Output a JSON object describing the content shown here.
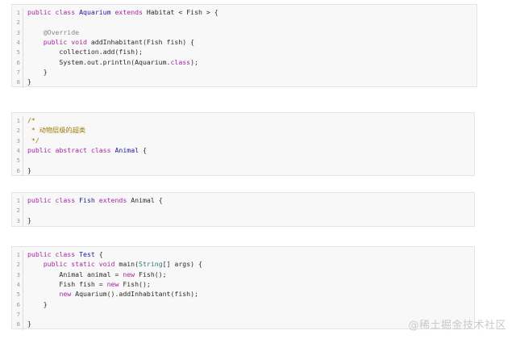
{
  "code_blocks": [
    {
      "lines": [
        {
          "n": "1",
          "tokens": [
            [
              "kw",
              "public"
            ],
            [
              "plain",
              " "
            ],
            [
              "kw",
              "class"
            ],
            [
              "plain",
              " "
            ],
            [
              "cls",
              "Aquarium"
            ],
            [
              "plain",
              " "
            ],
            [
              "kw",
              "extends"
            ],
            [
              "plain",
              " Habitat < Fish > {"
            ]
          ]
        },
        {
          "n": "2",
          "tokens": []
        },
        {
          "n": "3",
          "tokens": [
            [
              "plain",
              "    "
            ],
            [
              "ann",
              "@Override"
            ]
          ]
        },
        {
          "n": "4",
          "tokens": [
            [
              "plain",
              "    "
            ],
            [
              "kw",
              "public"
            ],
            [
              "plain",
              " "
            ],
            [
              "kw",
              "void"
            ],
            [
              "plain",
              " addInhabitant(Fish fish) {"
            ]
          ]
        },
        {
          "n": "5",
          "tokens": [
            [
              "plain",
              "        collection.add(fish);"
            ]
          ]
        },
        {
          "n": "6",
          "tokens": [
            [
              "plain",
              "        System.out.println(Aquarium."
            ],
            [
              "kw",
              "class"
            ],
            [
              "plain",
              ");"
            ]
          ]
        },
        {
          "n": "7",
          "tokens": [
            [
              "plain",
              "    }"
            ]
          ]
        },
        {
          "n": "8",
          "tokens": [
            [
              "plain",
              "}"
            ]
          ]
        }
      ]
    },
    {
      "lines": [
        {
          "n": "1",
          "tokens": [
            [
              "com",
              "/*"
            ]
          ]
        },
        {
          "n": "2",
          "tokens": [
            [
              "com",
              " * 动物层级的超类"
            ]
          ]
        },
        {
          "n": "3",
          "tokens": [
            [
              "com",
              " */"
            ]
          ]
        },
        {
          "n": "4",
          "tokens": [
            [
              "kw",
              "public"
            ],
            [
              "plain",
              " "
            ],
            [
              "kw",
              "abstract"
            ],
            [
              "plain",
              " "
            ],
            [
              "kw",
              "class"
            ],
            [
              "plain",
              " "
            ],
            [
              "cls",
              "Animal"
            ],
            [
              "plain",
              " {"
            ]
          ]
        },
        {
          "n": "5",
          "tokens": []
        },
        {
          "n": "6",
          "tokens": [
            [
              "plain",
              "}"
            ]
          ]
        }
      ]
    },
    {
      "lines": [
        {
          "n": "1",
          "tokens": [
            [
              "kw",
              "public"
            ],
            [
              "plain",
              " "
            ],
            [
              "kw",
              "class"
            ],
            [
              "plain",
              " "
            ],
            [
              "cls",
              "Fish"
            ],
            [
              "plain",
              " "
            ],
            [
              "kw",
              "extends"
            ],
            [
              "plain",
              " Animal {"
            ]
          ]
        },
        {
          "n": "2",
          "tokens": []
        },
        {
          "n": "3",
          "tokens": [
            [
              "plain",
              "}"
            ]
          ]
        }
      ]
    },
    {
      "lines": [
        {
          "n": "1",
          "tokens": [
            [
              "kw",
              "public"
            ],
            [
              "plain",
              " "
            ],
            [
              "kw",
              "class"
            ],
            [
              "plain",
              " "
            ],
            [
              "cls",
              "Test"
            ],
            [
              "plain",
              " {"
            ]
          ]
        },
        {
          "n": "2",
          "tokens": [
            [
              "plain",
              "    "
            ],
            [
              "kw",
              "public"
            ],
            [
              "plain",
              " "
            ],
            [
              "kw",
              "static"
            ],
            [
              "plain",
              " "
            ],
            [
              "kw",
              "void"
            ],
            [
              "plain",
              " main("
            ],
            [
              "bi",
              "String"
            ],
            [
              "plain",
              "[] args) {"
            ]
          ]
        },
        {
          "n": "3",
          "tokens": [
            [
              "plain",
              "        Animal animal = "
            ],
            [
              "kw",
              "new"
            ],
            [
              "plain",
              " Fish();"
            ]
          ]
        },
        {
          "n": "4",
          "tokens": [
            [
              "plain",
              "        Fish fish = "
            ],
            [
              "kw",
              "new"
            ],
            [
              "plain",
              " Fish();"
            ]
          ]
        },
        {
          "n": "5",
          "tokens": [
            [
              "plain",
              "        "
            ],
            [
              "kw",
              "new"
            ],
            [
              "plain",
              " Aquarium().addInhabitant(fish);"
            ]
          ]
        },
        {
          "n": "6",
          "tokens": [
            [
              "plain",
              "    }"
            ]
          ]
        },
        {
          "n": "7",
          "tokens": []
        },
        {
          "n": "8",
          "tokens": [
            [
              "plain",
              "}"
            ]
          ]
        }
      ]
    }
  ],
  "watermark": "@稀土掘金技术社区"
}
